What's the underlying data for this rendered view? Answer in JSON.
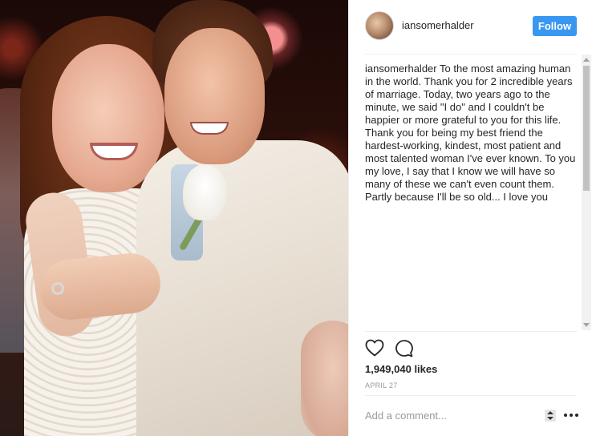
{
  "post": {
    "username": "iansomerhalder",
    "follow_label": "Follow",
    "caption_user": "iansomerhalder",
    "caption_text": "To the most amazing human in the world. Thank you for 2 incredible years of marriage. Today, two years ago to the minute, we said \"I do\" and I couldn't be happier or more grateful to you for this life. Thank you for being my best friend the hardest-working, kindest, most patient and most talented woman I've ever known. To you my love, I say that I know we will have so many of these we can't even count them. Partly because I'll be so old... I love you",
    "likes": "1,949,040 likes",
    "date": "APRIL 27",
    "comment_placeholder": "Add a comment..."
  },
  "icons": {
    "like": "heart-icon",
    "comment": "comment-icon",
    "more": "more-options-icon",
    "resize": "resize-icon"
  },
  "colors": {
    "follow_button": "#3897f0",
    "text": "#262626",
    "muted": "#999999",
    "divider": "#efefef"
  }
}
